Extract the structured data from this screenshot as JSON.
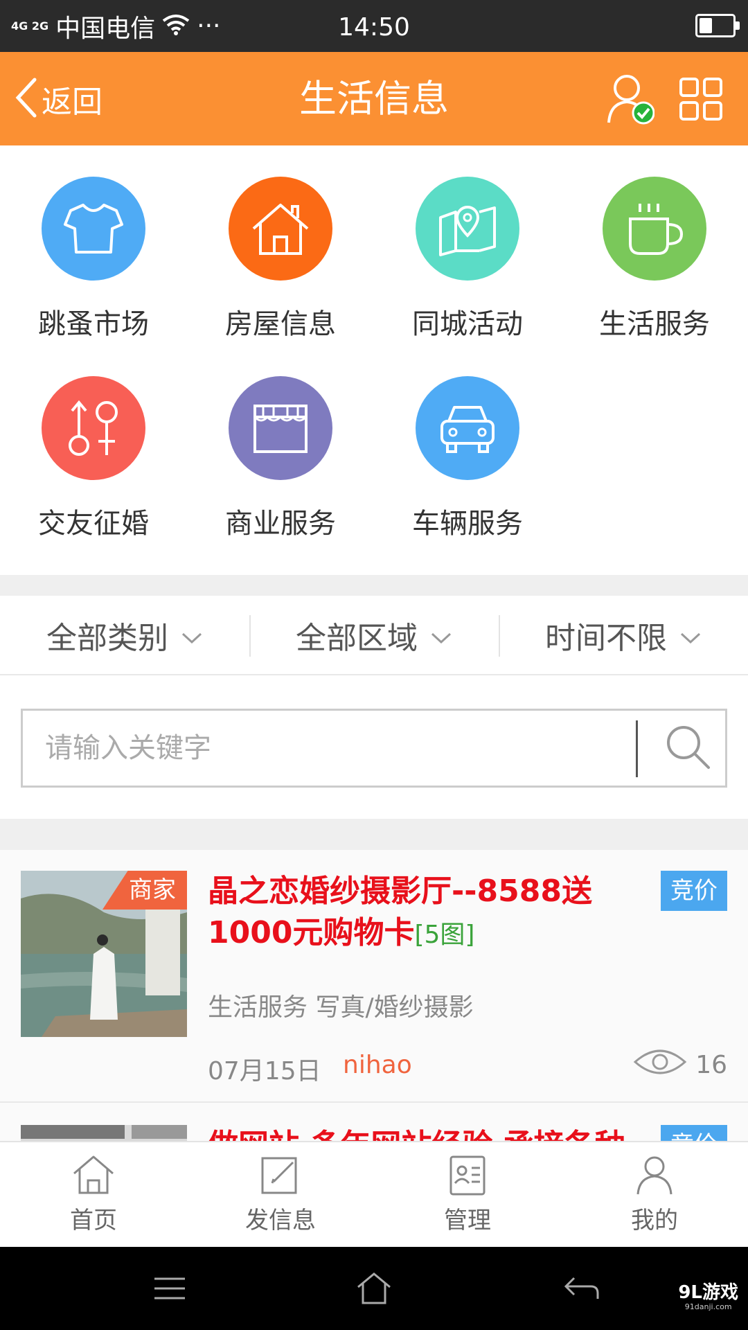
{
  "status_bar": {
    "network": "4G 2G",
    "carrier": "中国电信",
    "more": "···",
    "time": "14:50",
    "battery_level": 0.35
  },
  "header": {
    "back_label": "返回",
    "title": "生活信息",
    "accent_color": "#fb9033",
    "user_icon": "user-verified-icon",
    "menu_icon": "grid-icon"
  },
  "categories": [
    {
      "label": "跳蚤市场",
      "icon": "tshirt-icon",
      "color": "#4fabf5"
    },
    {
      "label": "房屋信息",
      "icon": "house-icon",
      "color": "#fb6a15"
    },
    {
      "label": "同城活动",
      "icon": "map-pin-icon",
      "color": "#5bdcc6"
    },
    {
      "label": "生活服务",
      "icon": "coffee-cup-icon",
      "color": "#7ac85a"
    },
    {
      "label": "交友征婚",
      "icon": "gender-icon",
      "color": "#f85f55"
    },
    {
      "label": "商业服务",
      "icon": "storefront-icon",
      "color": "#7f7bbf"
    },
    {
      "label": "车辆服务",
      "icon": "car-icon",
      "color": "#4fabf5"
    }
  ],
  "filters": [
    {
      "label": "全部类别"
    },
    {
      "label": "全部区域"
    },
    {
      "label": "时间不限"
    }
  ],
  "search": {
    "placeholder": "请输入关键字",
    "value": ""
  },
  "listings": [
    {
      "merchant_badge": "商家",
      "title": "晶之恋婚纱摄影厅--8588送1000元购物卡",
      "pics": "[5图]",
      "bid_badge": "竞价",
      "category": "生活服务 写真/婚纱摄影",
      "date": "07月15日",
      "user": "nihao",
      "views": "16"
    },
    {
      "merchant_badge": "",
      "title": "做网站 多年网站经验 承接各种",
      "pics": "",
      "bid_badge": "竞价",
      "category": "",
      "date": "",
      "user": "",
      "views": ""
    }
  ],
  "tabs": [
    {
      "label": "首页",
      "icon": "home-icon"
    },
    {
      "label": "发信息",
      "icon": "edit-icon"
    },
    {
      "label": "管理",
      "icon": "id-card-icon"
    },
    {
      "label": "我的",
      "icon": "person-icon"
    }
  ],
  "watermark": {
    "main": "9L游戏",
    "sub": "91danji.com"
  }
}
